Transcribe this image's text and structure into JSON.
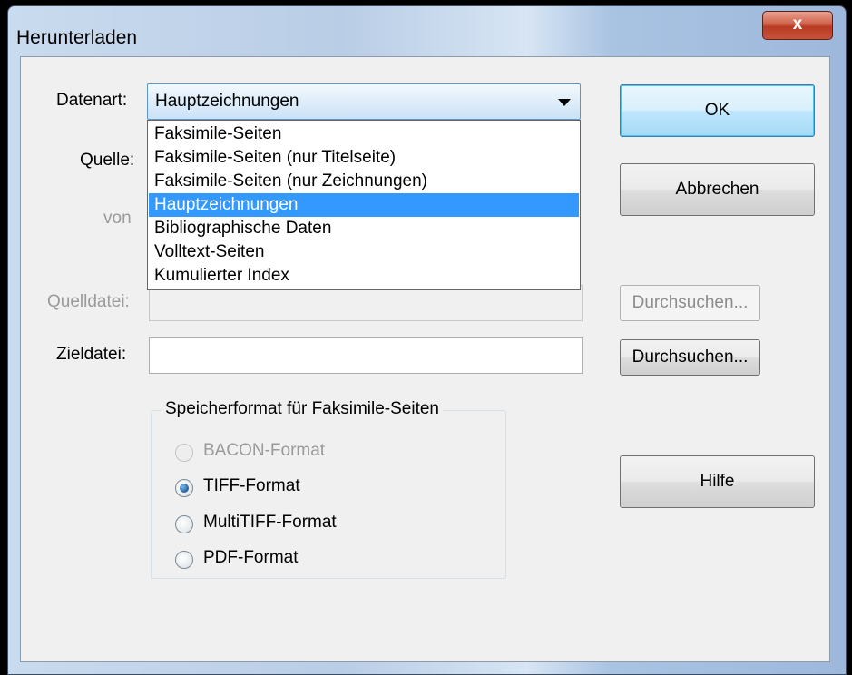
{
  "window": {
    "title": "Herunterladen",
    "close_label": "x"
  },
  "form": {
    "datenart_label": "Datenart:",
    "datenart_value": "Hauptzeichnungen",
    "datenart_options": [
      "Faksimile-Seiten",
      "Faksimile-Seiten (nur Titelseite)",
      "Faksimile-Seiten (nur Zeichnungen)",
      "Hauptzeichnungen",
      "Bibliographische Daten",
      "Volltext-Seiten",
      "Kumulierter Index"
    ],
    "selected_index": 3,
    "quelle_label": "Quelle:",
    "von_label": "von",
    "quelldatei_label": "Quelldatei:",
    "zieldatei_label": "Zieldatei:",
    "quelldatei_value": "",
    "zieldatei_value": ""
  },
  "buttons": {
    "ok": "OK",
    "cancel": "Abbrechen",
    "browse_source": "Durchsuchen...",
    "browse_target": "Durchsuchen...",
    "help": "Hilfe"
  },
  "format_group": {
    "title": "Speicherformat für Faksimile-Seiten",
    "options": [
      {
        "label": "BACON-Format",
        "checked": false,
        "enabled": false
      },
      {
        "label": "TIFF-Format",
        "checked": true,
        "enabled": true
      },
      {
        "label": "MultiTIFF-Format",
        "checked": false,
        "enabled": true
      },
      {
        "label": "PDF-Format",
        "checked": false,
        "enabled": true
      }
    ]
  },
  "colors": {
    "selection": "#3399ff",
    "close_button": "#c9513a",
    "dialog_face": "#f0f0f0"
  }
}
